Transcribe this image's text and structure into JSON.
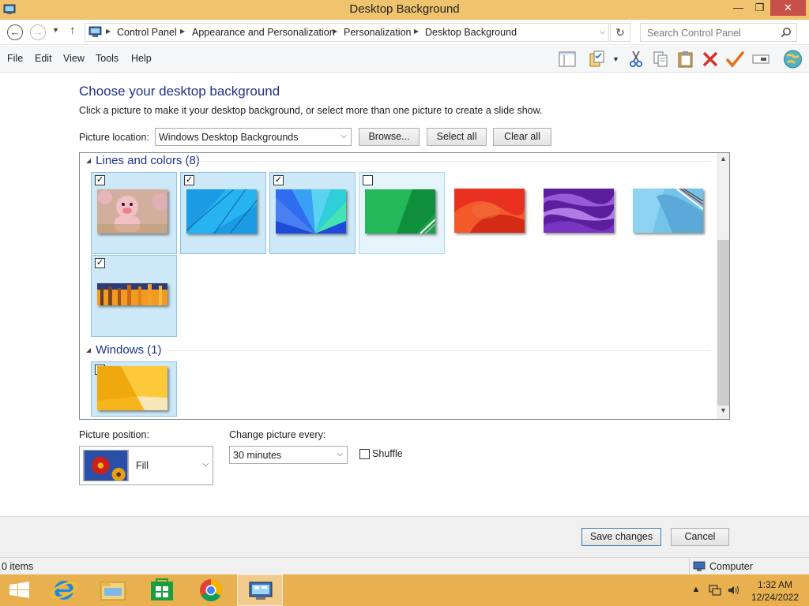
{
  "window": {
    "title": "Desktop Background",
    "min_glyph": "—",
    "max_glyph": "❐",
    "close_glyph": "✕"
  },
  "address": {
    "back_glyph": "←",
    "forward_glyph": "→",
    "dropdown_glyph": "▼",
    "up_glyph": "↑",
    "breadcrumbs": [
      "Control Panel",
      "Appearance and Personalization",
      "Personalization",
      "Desktop Background"
    ],
    "refresh_glyph": "↻",
    "search_placeholder": "Search Control Panel"
  },
  "menu": {
    "items": [
      "File",
      "Edit",
      "View",
      "Tools",
      "Help"
    ]
  },
  "toolbar": {
    "icons": [
      "layout-pane-icon",
      "properties-icon",
      "cut-icon",
      "copy-icon",
      "paste-icon",
      "delete-icon",
      "check-icon",
      "rename-icon",
      "globe-icon"
    ]
  },
  "main": {
    "heading": "Choose your desktop background",
    "instructions": "Click a picture to make it your desktop background, or select more than one picture to create a slide show.",
    "picture_location_label": "Picture location:",
    "picture_location_value": "Windows Desktop Backgrounds",
    "browse_label": "Browse...",
    "select_all_label": "Select all",
    "clear_all_label": "Clear all"
  },
  "gallery": {
    "groups": [
      {
        "title": "Lines and colors (8)",
        "items": [
          {
            "name": "cartoon-pig",
            "checked": true
          },
          {
            "name": "blue-lines",
            "checked": true
          },
          {
            "name": "blue-fan",
            "checked": true
          },
          {
            "name": "green-lines",
            "checked": false
          },
          {
            "name": "red-swirl",
            "checked": null
          },
          {
            "name": "purple-waves",
            "checked": null
          },
          {
            "name": "light-blue-lines",
            "checked": null
          },
          {
            "name": "orange-bars",
            "checked": true
          }
        ]
      },
      {
        "title": "Windows (1)",
        "items": [
          {
            "name": "yellow-windows",
            "checked": true
          }
        ]
      }
    ],
    "checkmark": "✓"
  },
  "options": {
    "picture_position_label": "Picture position:",
    "picture_position_value": "Fill",
    "change_every_label": "Change picture every:",
    "change_every_value": "30 minutes",
    "shuffle_label": "Shuffle",
    "shuffle_checked": false
  },
  "footer": {
    "save_label": "Save changes",
    "cancel_label": "Cancel"
  },
  "status": {
    "items_text": "0 items",
    "location_text": "Computer"
  },
  "taskbar": {
    "apps": [
      "start-button",
      "internet-explorer",
      "file-explorer",
      "store",
      "chrome",
      "control-panel"
    ],
    "time": "1:32 AM",
    "date": "12/24/2022"
  },
  "colors": {
    "titlebar": "#f0c46e",
    "taskbar": "#e8b04e",
    "heading": "#1e3287",
    "close": "#c7504a"
  }
}
